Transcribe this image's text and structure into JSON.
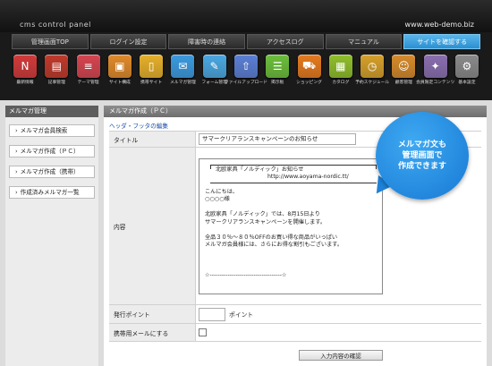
{
  "header": {
    "brand": "cms control panel",
    "site_url": "www.web-demo.biz"
  },
  "nav": [
    {
      "label": "管理画面TOP",
      "active": false
    },
    {
      "label": "ログイン設定",
      "active": false
    },
    {
      "label": "障害時の連絡",
      "active": false
    },
    {
      "label": "アクセスログ",
      "active": false
    },
    {
      "label": "マニュアル",
      "active": false
    },
    {
      "label": "サイトを確認する",
      "active": true
    }
  ],
  "icons": [
    {
      "label": "最新情報",
      "icon": "news-icon",
      "color": "#d23a3a",
      "glyph": "N"
    },
    {
      "label": "記事管理",
      "icon": "article-icon",
      "color": "#c0392b",
      "glyph": "▤"
    },
    {
      "label": "テーマ管理",
      "icon": "theme-icon",
      "color": "#d64550",
      "glyph": "≡"
    },
    {
      "label": "サイト構成",
      "icon": "site-structure-icon",
      "color": "#e08a2a",
      "glyph": "▣"
    },
    {
      "label": "携帯サイト",
      "icon": "mobile-site-icon",
      "color": "#e6b02a",
      "glyph": "▯"
    },
    {
      "label": "メルマガ管理",
      "icon": "mail-magazine-icon",
      "color": "#3b9be0",
      "glyph": "✉"
    },
    {
      "label": "フォーム管理",
      "icon": "form-icon",
      "color": "#4aa8e2",
      "glyph": "✎"
    },
    {
      "label": "ファイルアップロード",
      "icon": "file-upload-icon",
      "color": "#5b7fd6",
      "glyph": "⇧"
    },
    {
      "label": "掲示板",
      "icon": "bbs-icon",
      "color": "#6cbf3b",
      "glyph": "☰"
    },
    {
      "label": "ショッピング",
      "icon": "shopping-icon",
      "color": "#e57a1e",
      "glyph": "⛟"
    },
    {
      "label": "カタログ",
      "icon": "catalog-icon",
      "color": "#8fbf2a",
      "glyph": "▦"
    },
    {
      "label": "予約スケジュール",
      "icon": "schedule-icon",
      "color": "#d6a02a",
      "glyph": "◷"
    },
    {
      "label": "顧客管理",
      "icon": "customer-icon",
      "color": "#d68a2a",
      "glyph": "☺"
    },
    {
      "label": "会員限定コンテンツ",
      "icon": "members-icon",
      "color": "#8a6fb0",
      "glyph": "✦"
    },
    {
      "label": "基本設定",
      "icon": "settings-icon",
      "color": "#8a8a8a",
      "glyph": "⚙"
    }
  ],
  "sidebar": {
    "title": "メルマガ管理",
    "items": [
      {
        "label": "メルマガ会員検索"
      },
      {
        "label": "メルマガ作成（ＰＣ）"
      },
      {
        "label": "メルマガ作成（携帯）"
      },
      {
        "label": "作成済みメルマガ一覧"
      }
    ]
  },
  "content": {
    "title": "メルマガ作成（ＰＣ）",
    "breadcrumb": "ヘッダ・フッタの編集",
    "fields": {
      "title_label": "タイトル",
      "title_value": "サマークリアランスキャンペーンのお知らせ",
      "body_label": "内容",
      "body_header_line1": "北欧家具「ノルディック」お知らせ",
      "body_header_line2": "http://www.aoyama-nordic.tt/",
      "body_lines": [
        "こんにちは、",
        "○○○○様",
        "",
        "北欧家具「ノルディック」では、8月15日より",
        "サマークリアランスキャンペーンを開催します。",
        "",
        "全品３０％～８０％OFFのお買い得な商品がいっぱい",
        "メルマガ会員様には、さらにお得な割引もございます。",
        "",
        "",
        "",
        "☆------------------------------------☆"
      ],
      "points_label": "発行ポイント",
      "points_value": "",
      "points_unit": "ポイント",
      "mobile_label": "携帯用メールにする",
      "confirm_button": "入力内容の確認"
    }
  },
  "callout": {
    "line1": "メルマガ文も",
    "line2": "管理画面で",
    "line3": "作成できます"
  }
}
